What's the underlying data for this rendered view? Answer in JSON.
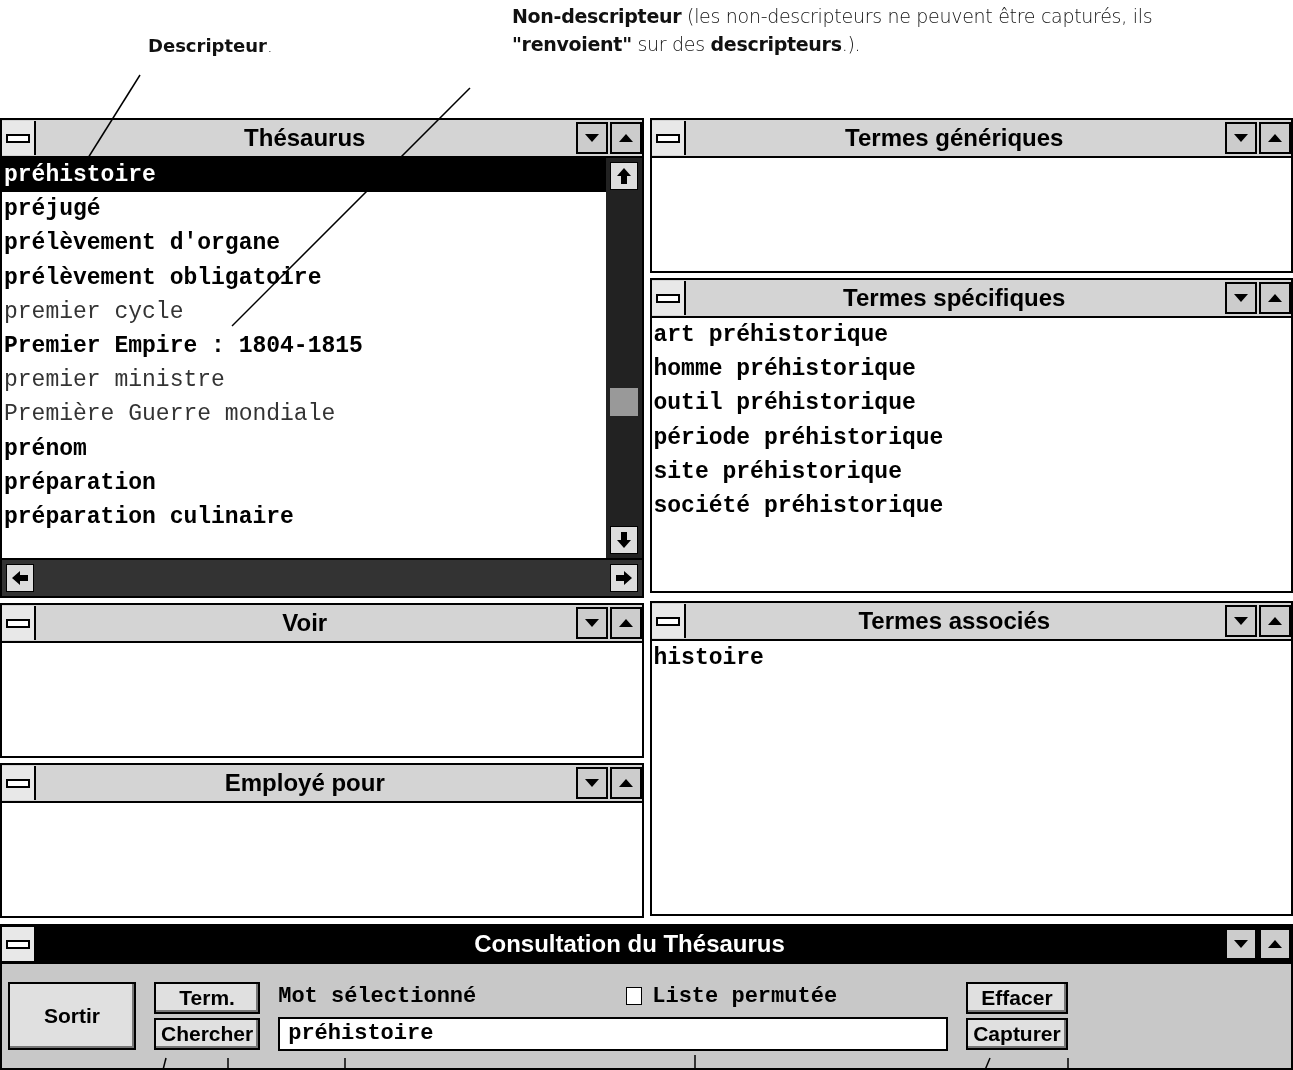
{
  "annotations": {
    "descriptor": "**Descripteur**.",
    "non_descriptor": "**Non-descripteur** (les non-descripteurs ne peuvent être capturés, ils **\"renvoient\"** sur des  **descripteurs**.)."
  },
  "thesaurus": {
    "title": "Thésaurus",
    "active": false,
    "items": [
      {
        "text": "préhistoire",
        "kind": "descriptor",
        "selected": true
      },
      {
        "text": "préjugé",
        "kind": "descriptor",
        "selected": false
      },
      {
        "text": "prélèvement d'organe",
        "kind": "descriptor",
        "selected": false
      },
      {
        "text": "prélèvement obligatoire",
        "kind": "descriptor",
        "selected": false
      },
      {
        "text": "premier cycle",
        "kind": "non_descriptor",
        "selected": false
      },
      {
        "text": "Premier Empire : 1804-1815",
        "kind": "descriptor",
        "selected": false
      },
      {
        "text": "premier ministre",
        "kind": "non_descriptor",
        "selected": false
      },
      {
        "text": "Première Guerre mondiale",
        "kind": "non_descriptor",
        "selected": false
      },
      {
        "text": "prénom",
        "kind": "descriptor",
        "selected": false
      },
      {
        "text": "préparation",
        "kind": "descriptor",
        "selected": false
      },
      {
        "text": "préparation culinaire",
        "kind": "descriptor",
        "selected": false
      }
    ]
  },
  "voir": {
    "title": "Voir",
    "active": false
  },
  "employe_pour": {
    "title": "Employé pour",
    "active": false
  },
  "termes_generiques": {
    "title": "Termes génériques",
    "active": false
  },
  "termes_specifiques": {
    "title": "Termes spécifiques",
    "active": false,
    "items": [
      "art préhistorique",
      "homme préhistorique",
      "outil préhistorique",
      "période préhistorique",
      "site préhistorique",
      "société préhistorique"
    ]
  },
  "termes_associes": {
    "title": "Termes associés",
    "active": false,
    "items": [
      "histoire"
    ]
  },
  "consultation": {
    "title": "Consultation du Thésaurus",
    "active": true,
    "buttons": {
      "sortir": "Sortir",
      "term": "Term.",
      "chercher": "Chercher",
      "effacer": "Effacer",
      "capturer": "Capturer"
    },
    "selected_word_label": "Mot sélectionné",
    "selected_word": "préhistoire",
    "permuted_list": {
      "label": "Liste permutée",
      "checked": false
    }
  }
}
